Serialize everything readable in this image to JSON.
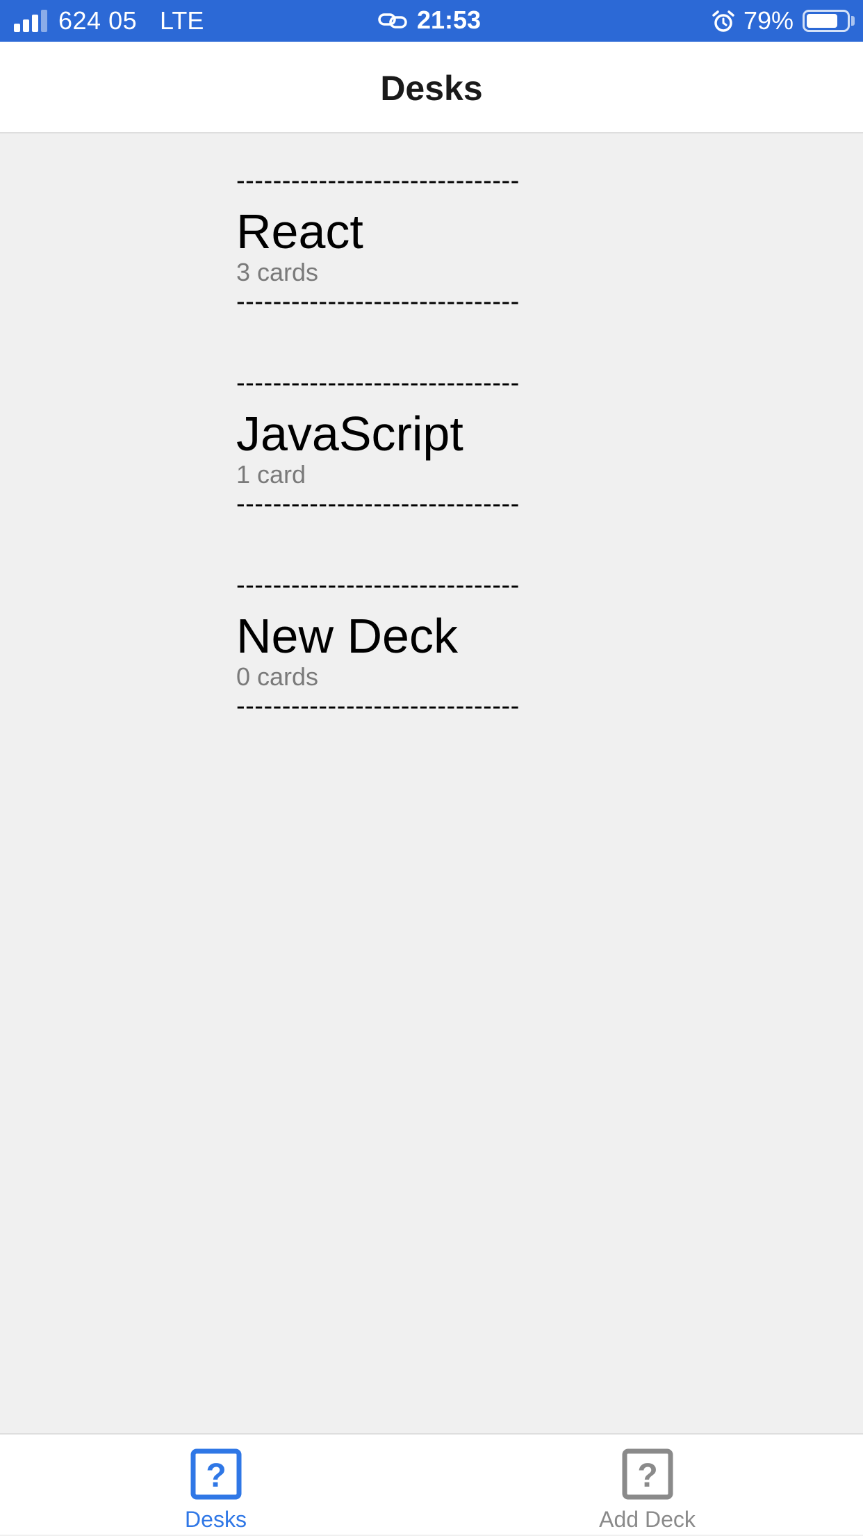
{
  "status_bar": {
    "carrier": "624 05",
    "network": "LTE",
    "time": "21:53",
    "battery_percent": "79%",
    "battery_level": 0.79,
    "signal_bars_filled": 3,
    "signal_bars_total": 4,
    "icons": [
      "signal-icon",
      "link-icon",
      "alarm-icon",
      "battery-icon"
    ],
    "background_color": "#2c69d6"
  },
  "header": {
    "title": "Desks"
  },
  "decks": [
    {
      "separator": "-------------------------------",
      "title": "React",
      "count": "3 cards"
    },
    {
      "separator": "-------------------------------",
      "title": "JavaScript",
      "count": "1 card"
    },
    {
      "separator": "-------------------------------",
      "title": "New Deck",
      "count": "0 cards"
    }
  ],
  "tab_bar": {
    "tabs": [
      {
        "label": "Desks",
        "icon": "question-square-icon",
        "active": true,
        "color": "#2f77e6"
      },
      {
        "label": "Add Deck",
        "icon": "question-square-icon",
        "active": false,
        "color": "#8a8a8a"
      }
    ]
  }
}
